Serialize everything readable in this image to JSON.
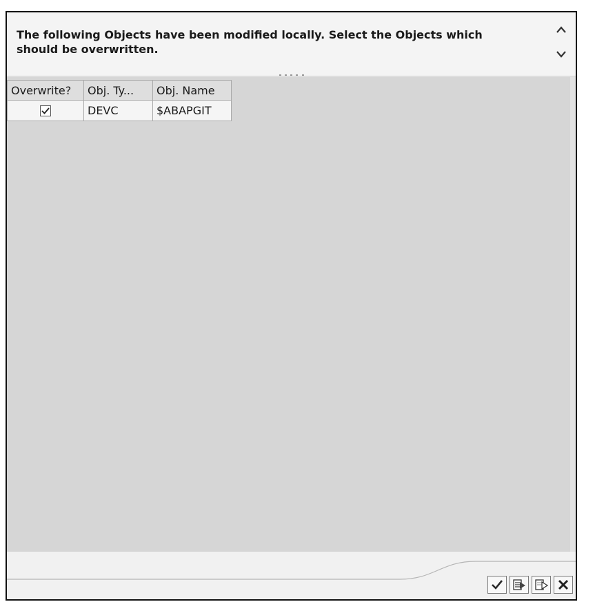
{
  "dialog": {
    "message": "The following Objects have been modified locally. Select the Objects which should be overwritten."
  },
  "table": {
    "columns": [
      "Overwrite?",
      "Obj. Ty...",
      "Obj. Name"
    ],
    "rows": [
      {
        "overwrite": true,
        "obj_type": "DEVC",
        "obj_name": "$ABAPGIT"
      }
    ]
  },
  "footer": {
    "buttons": [
      "confirm-icon",
      "select-all-icon",
      "deselect-all-icon",
      "cancel-icon"
    ]
  },
  "colors": {
    "grid_background": "#d6d6d6",
    "frame_border": "#111111"
  }
}
